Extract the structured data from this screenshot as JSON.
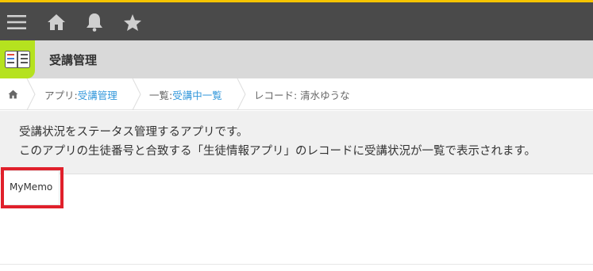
{
  "topbar": {
    "icons": [
      "menu-icon",
      "home-icon",
      "bell-icon",
      "star-icon"
    ],
    "colors": {
      "background": "#4a4a4a",
      "accent_line": "#f5c400",
      "icon": "#d0d0d0"
    }
  },
  "app": {
    "title": "受講管理",
    "icon": "app-book-icon",
    "icon_bg": "#b5e21f"
  },
  "breadcrumb": {
    "home_icon": "home-icon",
    "items": [
      {
        "prefix": "アプリ: ",
        "link": "受講管理"
      },
      {
        "prefix": "一覧: ",
        "link": "受講中一覧"
      },
      {
        "prefix": "レコード: 清水ゆうな",
        "link": ""
      }
    ],
    "link_color": "#3498db"
  },
  "description": {
    "line1": "受講状況をステータス管理するアプリです。",
    "line2": "このアプリの生徒番号と合致する「生徒情報アプリ」のレコードに受講状況が一覧で表示されます。"
  },
  "memo": {
    "label": "MyMemo",
    "highlight_color": "#e0202b"
  }
}
